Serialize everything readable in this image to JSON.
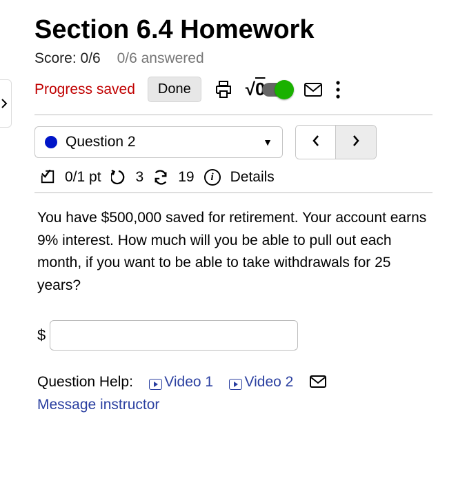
{
  "header": {
    "title": "Section 6.4 Homework",
    "score_label": "Score: 0/6",
    "answered_label": "0/6 answered"
  },
  "toolbar": {
    "progress": "Progress saved",
    "done": "Done"
  },
  "question_nav": {
    "current": "Question 2",
    "prev": "<",
    "next": ">"
  },
  "meta": {
    "points": "0/1 pt",
    "retries": "3",
    "regen": "19",
    "details": "Details"
  },
  "question": {
    "text": "You have $500,000 saved for retirement. Your account earns 9% interest. How much will you be able to pull out each month, if you want to be able to take withdrawals for 25 years?",
    "prefix": "$",
    "answer_value": ""
  },
  "help": {
    "label": "Question Help:",
    "video1": "Video 1",
    "video2": "Video 2",
    "message": "Message instructor"
  }
}
